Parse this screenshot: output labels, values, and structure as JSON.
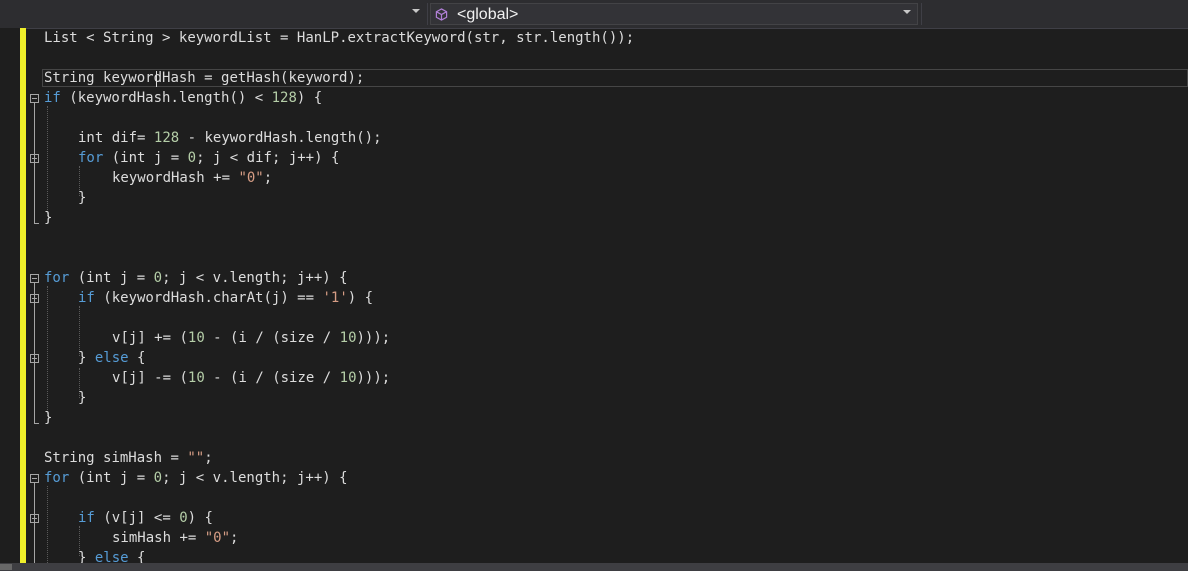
{
  "navigation": {
    "scope_label": "<global>",
    "scope_icon": "cube-icon"
  },
  "code_lines": [
    "List < String > keywordList = HanLP.extractKeyword(str, str.length());",
    "",
    "String keywordHash = getHash(keyword);",
    "if (keywordHash.length() < 128) {",
    "",
    "int dif= 128 - keywordHash.length();",
    "for (int j = 0; j < dif; j++) {",
    "keywordHash += \"0\";",
    "}",
    "}",
    "",
    "",
    "for (int j = 0; j < v.length; j++) {",
    "if (keywordHash.charAt(j) == '1') {",
    "",
    "v[j] += (10 - (i / (size / 10)));",
    "} else {",
    "v[j] -= (10 - (i / (size / 10)));",
    "}",
    "}",
    "",
    "String simHash = \"\";",
    "for (int j = 0; j < v.length; j++) {",
    "",
    "if (v[j] <= 0) {",
    "simHash += \"0\";",
    "} else {"
  ],
  "colors": {
    "keyword": "#569cd6",
    "number": "#b5cea8",
    "string": "#d69d85",
    "text": "#dcdcdc",
    "change_bar": "#efef2a",
    "background": "#1e1e1e"
  }
}
